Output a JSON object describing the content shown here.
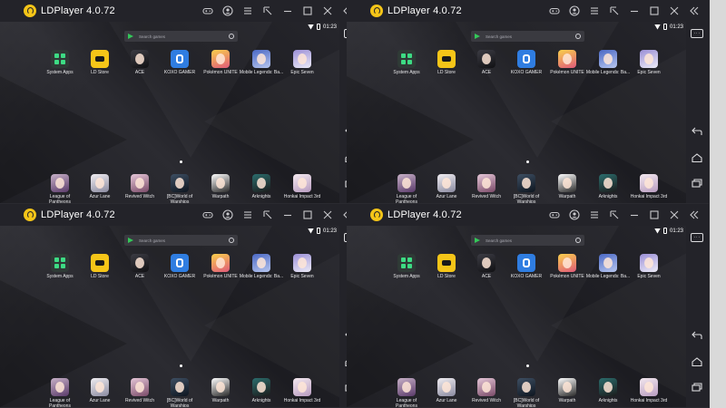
{
  "app_title": "LDPlayer 4.0.72",
  "status_time": "01:23",
  "search_placeholder": "Search games",
  "sidebar_more": "···",
  "top_apps": [
    {
      "label": "System Apps",
      "icon": "system-apps-icon",
      "style": "ic-system"
    },
    {
      "label": "LD Store",
      "icon": "ld-store-icon",
      "style": "ic-ld"
    },
    {
      "label": "ACE",
      "icon": "ace-icon",
      "style": "ic-ace"
    },
    {
      "label": "KOXO GAMER",
      "icon": "koxo-gamer-icon",
      "style": "ic-koxo"
    },
    {
      "label": "Pokémon UNITE",
      "icon": "pokemon-unite-icon",
      "style": "ic-poke"
    },
    {
      "label": "Mobile Legends: Ba...",
      "icon": "mobile-legends-icon",
      "style": "ic-mlbb"
    },
    {
      "label": "Epic Seven",
      "icon": "epic-seven-icon",
      "style": "ic-epic"
    }
  ],
  "bottom_apps": [
    {
      "label": "League of\nPantheons",
      "icon": "league-of-pantheons-icon",
      "style": "ic-lop"
    },
    {
      "label": "Azur Lane",
      "icon": "azur-lane-icon",
      "style": "ic-azur"
    },
    {
      "label": "Revived Witch",
      "icon": "revived-witch-icon",
      "style": "ic-revived"
    },
    {
      "label": "[BC]World of\nWarships",
      "icon": "world-of-warships-icon",
      "style": "ic-wow"
    },
    {
      "label": "Warpath",
      "icon": "warpath-icon",
      "style": "ic-warpath"
    },
    {
      "label": "Arknights",
      "icon": "arknights-icon",
      "style": "ic-ark"
    },
    {
      "label": "Honkai Impact 3rd",
      "icon": "honkai-impact-icon",
      "style": "ic-honkai"
    }
  ],
  "titlebar_icons": [
    "gamepad-icon",
    "account-icon",
    "menu-icon",
    "shrink-icon",
    "minimize-icon",
    "maximize-icon",
    "close-icon",
    "collapse-sidebar-icon"
  ],
  "sidebar_icons": [
    "more-icon",
    "back-icon",
    "home-icon",
    "recent-apps-icon"
  ]
}
